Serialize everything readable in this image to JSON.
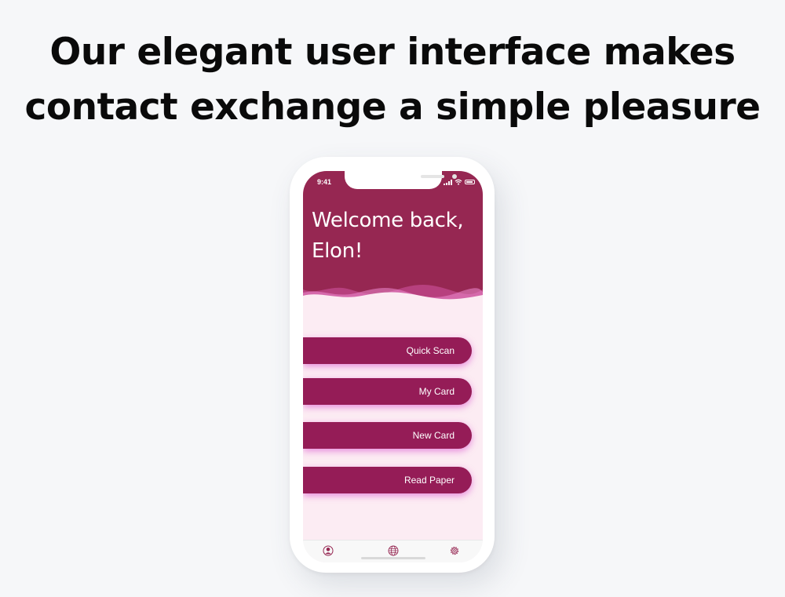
{
  "headline": {
    "line1": "Our elegant user interface makes",
    "line2": "contact exchange a simple pleasure"
  },
  "status_bar": {
    "time": "9:41",
    "icons": [
      "signal-icon",
      "wifi-icon",
      "battery-icon"
    ]
  },
  "welcome": {
    "line1": "Welcome back,",
    "line2": "Elon!"
  },
  "actions": [
    {
      "label": "Quick Scan"
    },
    {
      "label": "My Card"
    },
    {
      "label": "New Card"
    },
    {
      "label": "Read Paper"
    }
  ],
  "tab_bar": {
    "tabs": [
      {
        "icon": "profile-icon",
        "active": true
      },
      {
        "icon": "globe-icon",
        "active": false
      },
      {
        "icon": "settings-icon",
        "active": false
      }
    ]
  },
  "colors": {
    "brand": "#962752",
    "button": "#951c57",
    "button_glow": "#d73cc8",
    "screen_background": "#fcecf3",
    "page_background": "#f6f7f9"
  }
}
